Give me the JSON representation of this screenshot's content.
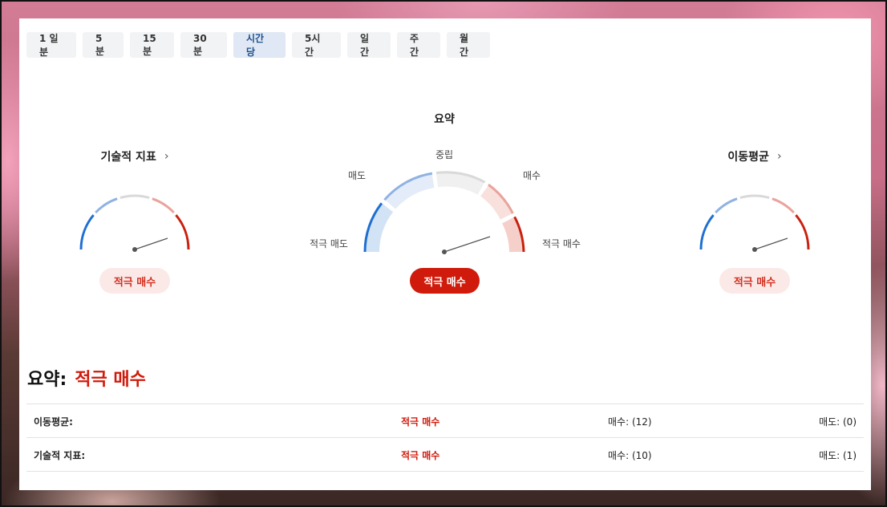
{
  "tabs": [
    {
      "label": "1 일분",
      "active": false
    },
    {
      "label": "5분",
      "active": false
    },
    {
      "label": "15분",
      "active": false
    },
    {
      "label": "30분",
      "active": false
    },
    {
      "label": "시간당",
      "active": true
    },
    {
      "label": "5시간",
      "active": false
    },
    {
      "label": "일간",
      "active": false
    },
    {
      "label": "주간",
      "active": false
    },
    {
      "label": "월간",
      "active": false
    }
  ],
  "gauges": {
    "left": {
      "title": "기술적 지표",
      "chevron": "›",
      "result": "적극 매수"
    },
    "center": {
      "title": "요약",
      "labels": {
        "neutral": "중립",
        "sell": "매도",
        "buy": "매수",
        "strong_sell": "적극 매도",
        "strong_buy": "적극 매수"
      },
      "result": "적극 매수"
    },
    "right": {
      "title": "이동평균",
      "chevron": "›",
      "result": "적극 매수"
    }
  },
  "summary": {
    "label": "요약:",
    "value": "적극 매수"
  },
  "table": [
    {
      "name": "이동평균:",
      "signal": "적극 매수",
      "buy": "매수: (12)",
      "sell": "매도: (0)"
    },
    {
      "name": "기술적 지표:",
      "signal": "적극 매수",
      "buy": "매수: (10)",
      "sell": "매도: (1)"
    }
  ],
  "colors": {
    "strong_sell": "#1f6fd1",
    "sell": "#8fb2e3",
    "neutral": "#d9d9d9",
    "buy": "#e9a39c",
    "strong_buy": "#c9200f"
  }
}
